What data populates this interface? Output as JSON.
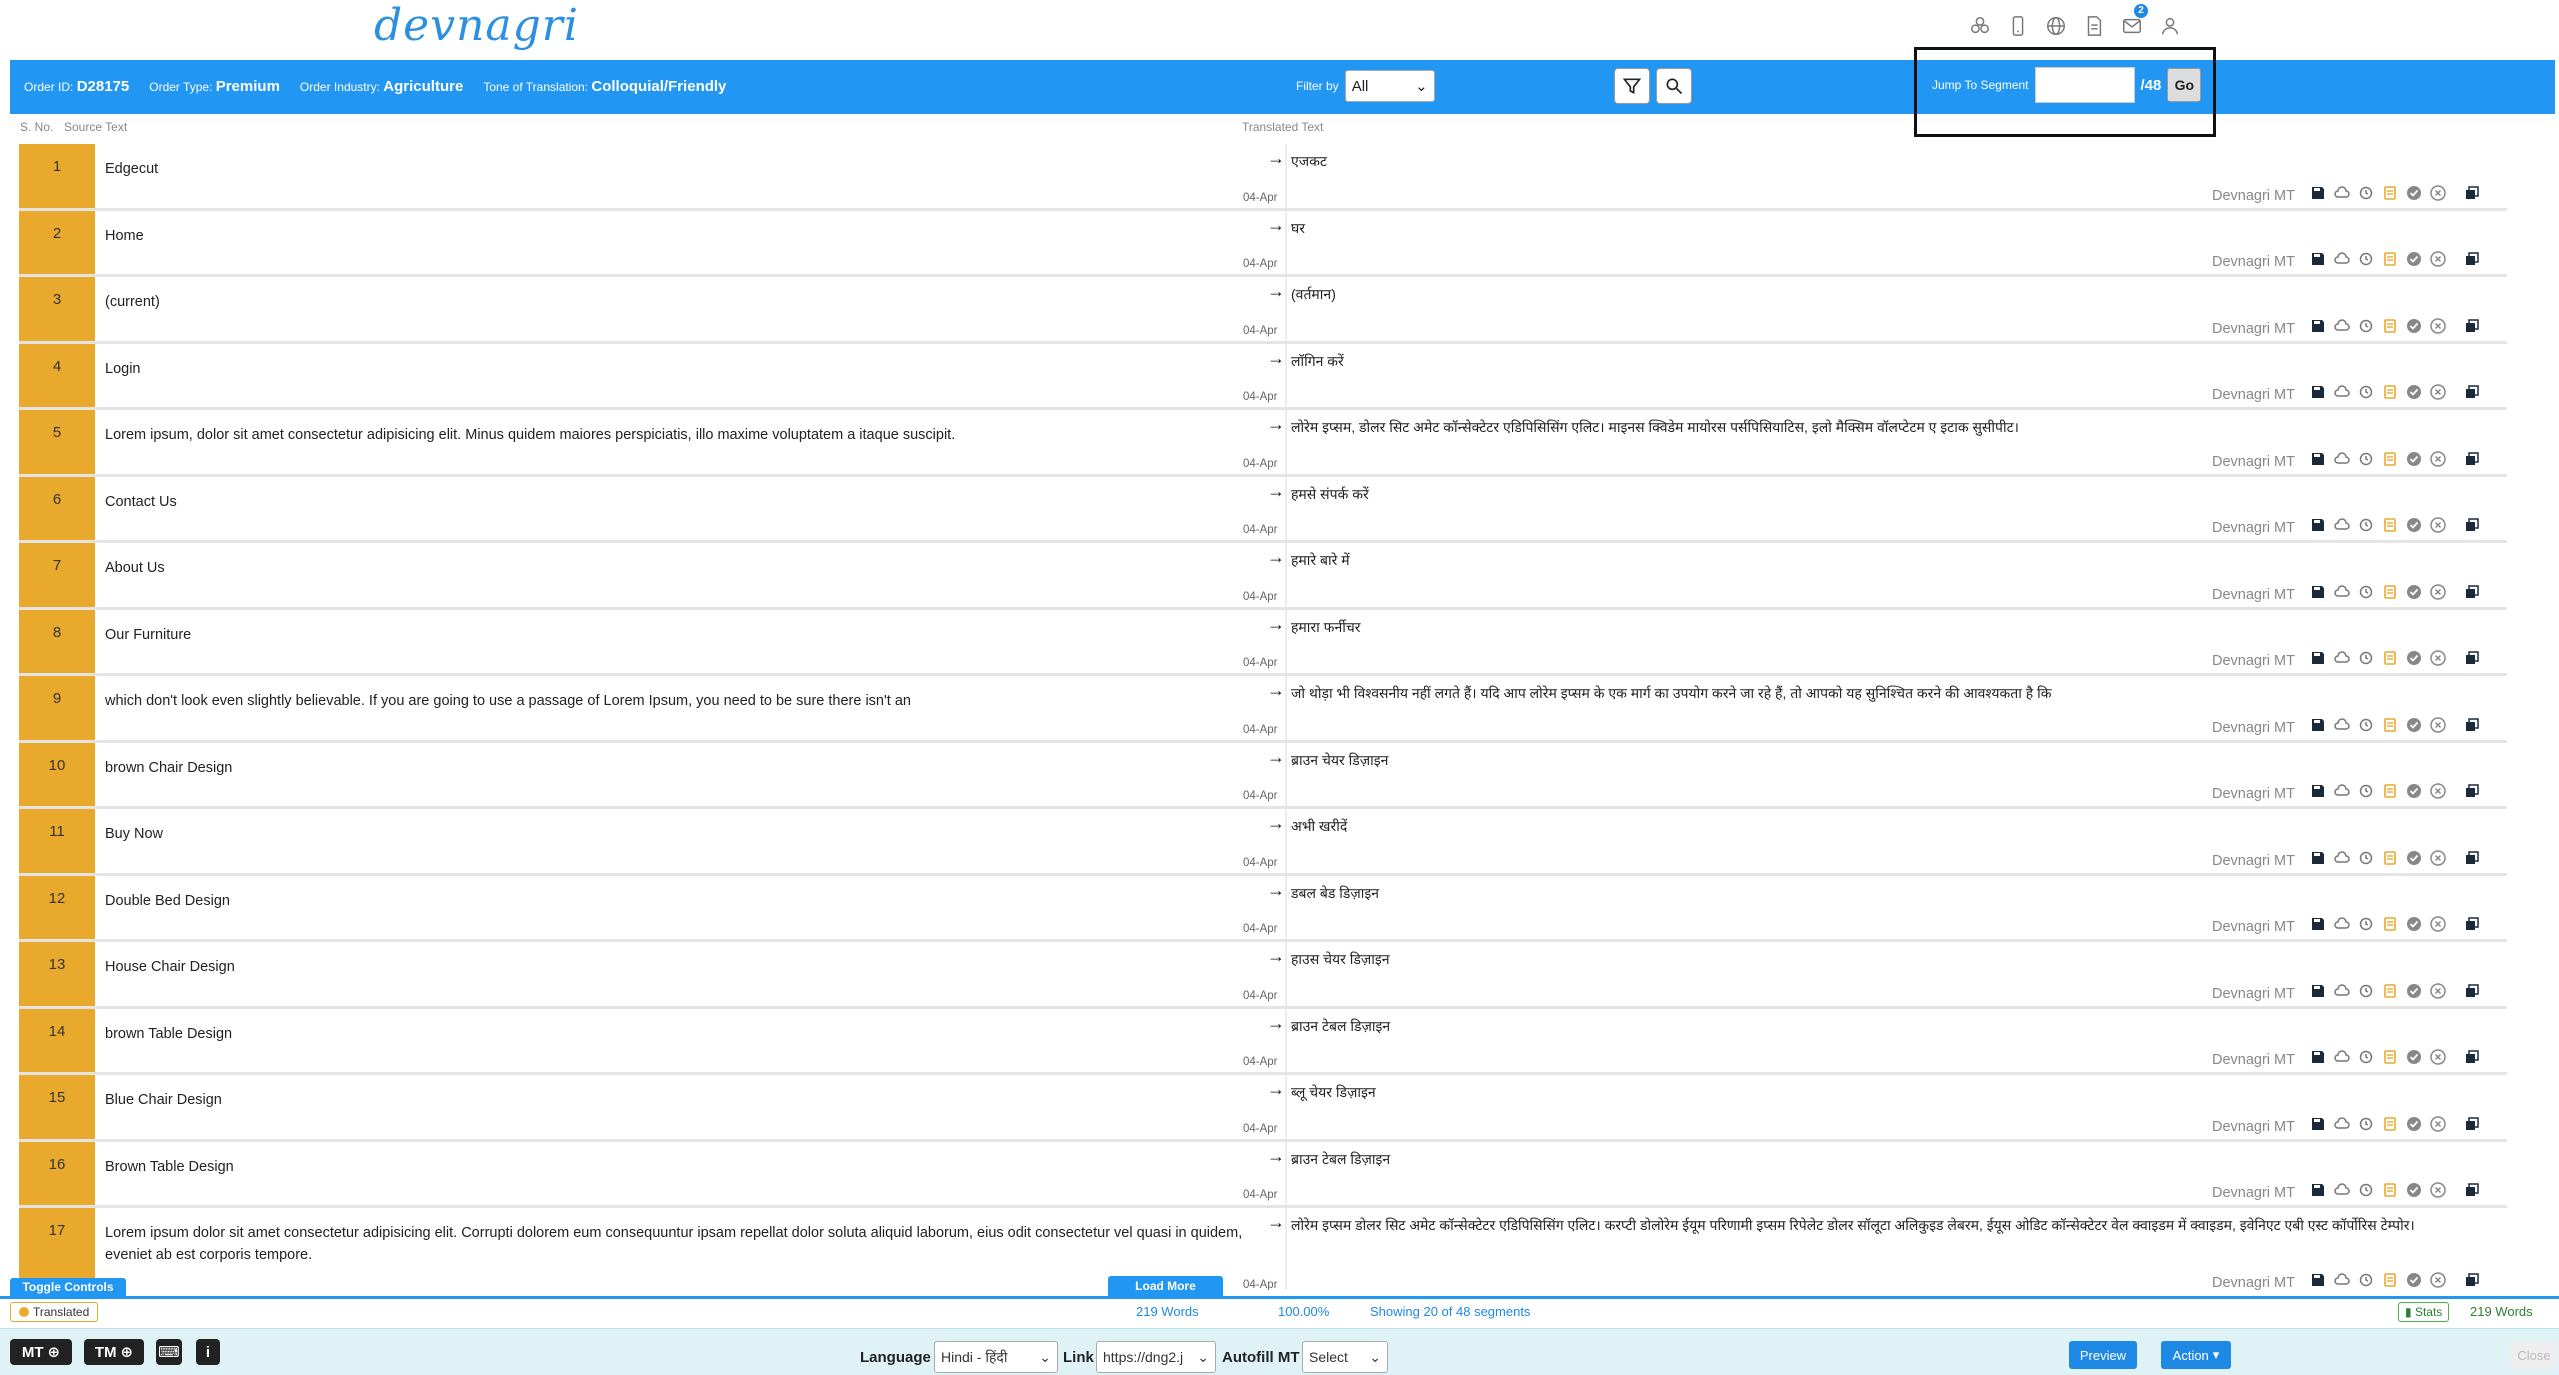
{
  "app": {
    "logo": "devnagri"
  },
  "top_icons": [
    "cluster-icon",
    "mobile-icon",
    "globe-icon",
    "document-icon",
    "mail-icon",
    "user-icon"
  ],
  "notifications": {
    "count": "2"
  },
  "order": {
    "id_label": "Order ID:",
    "id": "D28175",
    "type_label": "Order Type:",
    "type": "Premium",
    "industry_label": "Order Industry:",
    "industry": "Agriculture",
    "tone_label": "Tone of Translation:",
    "tone": "Colloquial/Friendly"
  },
  "filter": {
    "label": "Filter by",
    "value": "All"
  },
  "jump": {
    "label": "Jump To Segment",
    "total": "/48",
    "go": "Go",
    "value": ""
  },
  "columns": {
    "sno": "S. No.",
    "source": "Source Text",
    "translated": "Translated Text"
  },
  "mt_label": "Devnagri MT",
  "segments": [
    {
      "n": "1",
      "src": "Edgecut",
      "tgt": "एजकट",
      "date": "04-Apr"
    },
    {
      "n": "2",
      "src": "Home",
      "tgt": "घर",
      "date": "04-Apr"
    },
    {
      "n": "3",
      "src": "(current)",
      "tgt": "(वर्तमान)",
      "date": "04-Apr"
    },
    {
      "n": "4",
      "src": "Login",
      "tgt": "लॉगिन करें",
      "date": "04-Apr"
    },
    {
      "n": "5",
      "src": "Lorem ipsum, dolor sit amet consectetur adipisicing elit. Minus quidem maiores perspiciatis, illo maxime voluptatem a itaque suscipit.",
      "tgt": "लोरेम इप्सम, डोलर सिट अमेट कॉन्सेक्टेटर एडिपिसिसिंग एलिट। माइनस क्विडेम मायोरस पर्सपिसियाटिस, इलो मैक्सिम वॉलप्टेटम ए इटाक सुसीपीट।",
      "date": "04-Apr"
    },
    {
      "n": "6",
      "src": "Contact Us",
      "tgt": "हमसे संपर्क करें",
      "date": "04-Apr"
    },
    {
      "n": "7",
      "src": "About Us",
      "tgt": "हमारे बारे में",
      "date": "04-Apr"
    },
    {
      "n": "8",
      "src": "Our Furniture",
      "tgt": "हमारा फर्नीचर",
      "date": "04-Apr"
    },
    {
      "n": "9",
      "src": "which don't look even slightly believable. If you are going to use a passage of Lorem Ipsum, you need to be sure there isn't an",
      "tgt": "जो थोड़ा भी विश्वसनीय नहीं लगते हैं। यदि आप लोरेम इप्सम के एक मार्ग का उपयोग करने जा रहे हैं, तो आपको यह सुनिश्चित करने की आवश्यकता है कि",
      "date": "04-Apr"
    },
    {
      "n": "10",
      "src": "brown Chair Design",
      "tgt": "ब्राउन चेयर डिज़ाइन",
      "date": "04-Apr"
    },
    {
      "n": "11",
      "src": "Buy Now",
      "tgt": "अभी खरीदें",
      "date": "04-Apr"
    },
    {
      "n": "12",
      "src": "Double Bed Design",
      "tgt": "डबल बेड डिज़ाइन",
      "date": "04-Apr"
    },
    {
      "n": "13",
      "src": "House Chair Design",
      "tgt": "हाउस चेयर डिज़ाइन",
      "date": "04-Apr"
    },
    {
      "n": "14",
      "src": "brown Table Design",
      "tgt": "ब्राउन टेबल डिज़ाइन",
      "date": "04-Apr"
    },
    {
      "n": "15",
      "src": "Blue Chair Design",
      "tgt": "ब्लू चेयर डिज़ाइन",
      "date": "04-Apr"
    },
    {
      "n": "16",
      "src": "Brown Table Design",
      "tgt": "ब्राउन टेबल डिज़ाइन",
      "date": "04-Apr"
    },
    {
      "n": "17",
      "src": "Lorem ipsum dolor sit amet consectetur adipisicing elit. Corrupti dolorem eum consequuntur ipsam repellat dolor soluta aliquid laborum, eius odit consectetur vel quasi in quidem, eveniet ab est corporis tempore.",
      "tgt": "लोरेम इप्सम डोलर सिट अमेट कॉन्सेक्टेटर एडिपिसिसिंग एलिट। करप्टी डोलोरेम ईयूम परिणामी इप्सम रिपेलेट डोलर सॉलूटा अलिकुइड लेबरम, ईयूस ओडिट कॉन्सेक्टेटर वेल क्वाइडम में क्वाइडम, इवेनिएट एबी एस्ट कॉर्पोरिस टेम्पोर।",
      "date": "04-Apr"
    }
  ],
  "status": {
    "toggle": "Toggle Controls",
    "load_more": "Load More",
    "translated": "Translated",
    "words": "219 Words",
    "percent": "100.00%",
    "showing": "Showing 20 of 48 segments",
    "stats": "Stats",
    "stats_words": "219 Words"
  },
  "footer": {
    "mt": "MT",
    "tm": "TM",
    "language_label": "Language",
    "language": "Hindi - हिंदी",
    "link_label": "Link",
    "link": "https://dng2.j",
    "autofill_label": "Autofill MT",
    "autofill": "Select",
    "preview": "Preview",
    "action": "Action",
    "close": "Close"
  },
  "colors": {
    "primary": "#2196f3",
    "segment": "#e9a92d",
    "footer": "#dff2f6"
  }
}
